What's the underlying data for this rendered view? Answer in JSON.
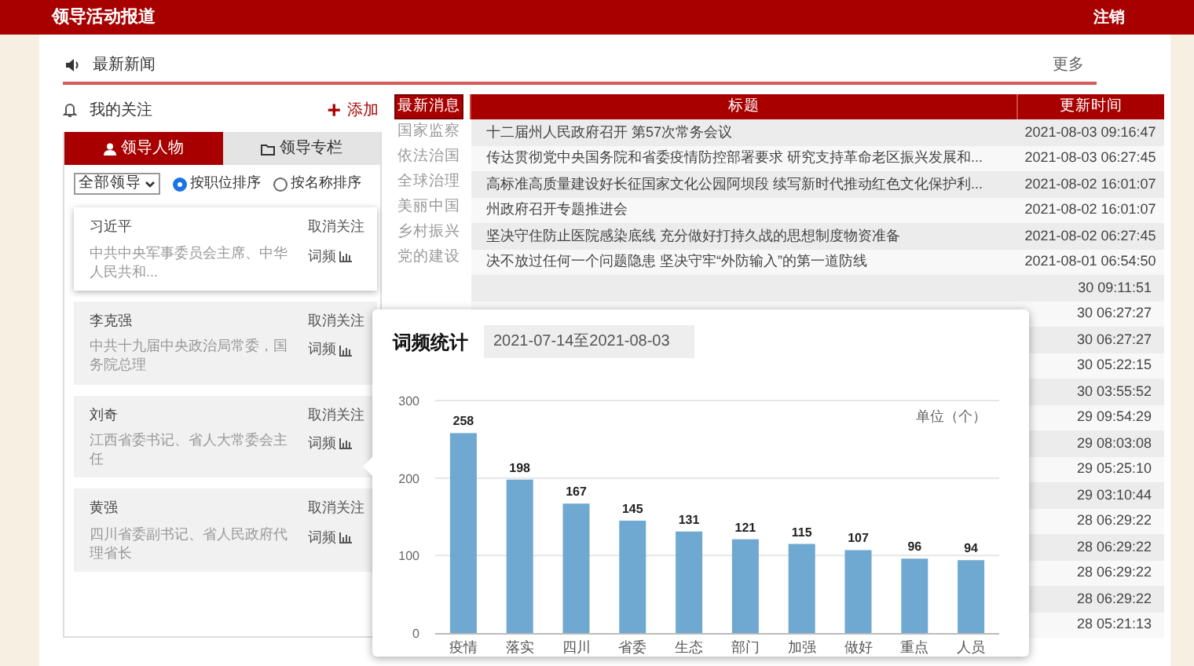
{
  "header": {
    "title": "领导活动报道",
    "logout": "注销"
  },
  "ticker": {
    "label": "最新新闻",
    "more": "更多"
  },
  "follow": {
    "title": "我的关注",
    "add_icon": "+",
    "add": "添加"
  },
  "tabs": [
    {
      "label": "领导人物",
      "selected": true
    },
    {
      "label": "领导专栏",
      "selected": false
    }
  ],
  "filter": {
    "value": "全部领导"
  },
  "sort_options": [
    {
      "label": "按职位排序",
      "selected": true
    },
    {
      "label": "按名称排序",
      "selected": false
    }
  ],
  "leaders": [
    {
      "name": "习近平",
      "title": "中共中央军事委员会主席、中华人民共和...",
      "unfollow": "取消关注",
      "freq": "词频",
      "selected": true
    },
    {
      "name": "李克强",
      "title": "中共十九届中央政治局常委，国务院总理",
      "unfollow": "取消关注",
      "freq": "词频",
      "selected": false
    },
    {
      "name": "刘奇",
      "title": "江西省委书记、省人大常委会主任",
      "unfollow": "取消关注",
      "freq": "词频",
      "selected": false
    },
    {
      "name": "黄强",
      "title": "四川省委副书记、省人民政府代理省长",
      "unfollow": "取消关注",
      "freq": "词频",
      "selected": false
    }
  ],
  "categories": [
    {
      "label": "最新消息",
      "selected": true
    },
    {
      "label": "国家监察",
      "selected": false
    },
    {
      "label": "依法治国",
      "selected": false
    },
    {
      "label": "全球治理",
      "selected": false
    },
    {
      "label": "美丽中国",
      "selected": false
    },
    {
      "label": "乡村振兴",
      "selected": false
    },
    {
      "label": "党的建设",
      "selected": false
    }
  ],
  "table": {
    "columns": [
      "标题",
      "更新时间"
    ],
    "rows": [
      {
        "title": "十二届州人民政府召开 第57次常务会议",
        "time": "2021-08-03 09:16:47"
      },
      {
        "title": "传达贯彻党中央国务院和省委疫情防控部署要求 研究支持革命老区振兴发展和...",
        "time": "2021-08-03 06:27:45"
      },
      {
        "title": "高标准高质量建设好长征国家文化公园阿坝段 续写新时代推动红色文化保护利...",
        "time": "2021-08-02 16:01:07"
      },
      {
        "title": "州政府召开专题推进会",
        "time": "2021-08-02 16:01:07"
      },
      {
        "title": "坚决守住防止医院感染底线 充分做好打持久战的思想制度物资准备",
        "time": "2021-08-02 06:27:45"
      },
      {
        "title": "决不放过任何一个问题隐患 坚决守牢“外防输入”的第一道防线",
        "time": "2021-08-01 06:54:50"
      },
      {
        "time": "30 09:11:51"
      },
      {
        "time": "30 06:27:27"
      },
      {
        "time": "30 06:27:27"
      },
      {
        "time": "30 05:22:15"
      },
      {
        "time": "30 03:55:52"
      },
      {
        "time": "29 09:54:29"
      },
      {
        "time": "29 08:03:08"
      },
      {
        "time": "29 05:25:10"
      },
      {
        "time": "29 03:10:44"
      },
      {
        "time": "28 06:29:22"
      },
      {
        "time": "28 06:29:22"
      },
      {
        "time": "28 06:29:22"
      },
      {
        "time": "28 06:29:22"
      },
      {
        "time": "28 05:21:13"
      }
    ]
  },
  "popup": {
    "title": "词频统计",
    "date_range": "2021-07-14至2021-08-03",
    "unit": "单位（个）",
    "chart_data": {
      "type": "bar",
      "categories": [
        "疫情",
        "落实",
        "四川",
        "省委",
        "生态",
        "部门",
        "加强",
        "做好",
        "重点",
        "人员"
      ],
      "series": [
        {
          "color": "#6fa8d1",
          "values": [
            258,
            198,
            167,
            145,
            131,
            121,
            115,
            107,
            96,
            94
          ]
        }
      ],
      "ylim": [
        0,
        300
      ],
      "yticks": [
        0,
        100,
        200,
        300
      ],
      "data_labels": true
    }
  }
}
